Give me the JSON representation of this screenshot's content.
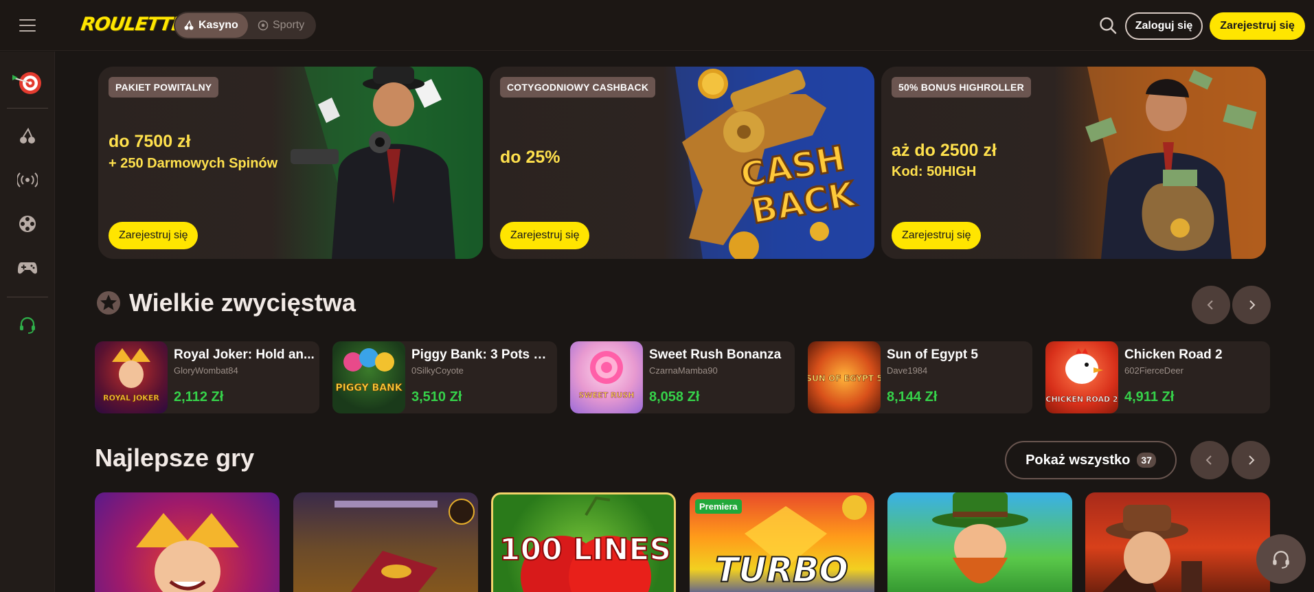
{
  "header": {
    "logo_text": "ROULETTINO",
    "tabs": [
      {
        "label": "Kasyno",
        "active": true
      },
      {
        "label": "Sporty",
        "active": false
      }
    ],
    "login_label": "Zaloguj się",
    "register_label": "Zarejestruj się"
  },
  "sidebar": {
    "items": [
      "dart-target-icon",
      "cherries-icon",
      "live-broadcast-icon",
      "film-reel-icon",
      "gamepad-icon",
      "headset-icon"
    ]
  },
  "banners": [
    {
      "tag": "PAKIET POWITALNY",
      "amount": "do 7500 zł",
      "sub": "+ 250 Darmowych Spinów",
      "cta": "Zarejestruj się"
    },
    {
      "tag": "COTYGODNIOWY CASHBACK",
      "amount": "do 25%",
      "sub": "",
      "cta": "Zarejestruj się",
      "art_text_1": "CASH",
      "art_text_2": "BACK"
    },
    {
      "tag": "50% BONUS HIGHROLLER",
      "amount": "aż do 2500 zł",
      "sub": "Kod: 50HIGH",
      "cta": "Zarejestruj się"
    }
  ],
  "big_wins": {
    "title": "Wielkie zwycięstwa",
    "items": [
      {
        "game": "Royal Joker: Hold an...",
        "user": "GloryWombat84",
        "prize": "2,112 Zł",
        "thumb_text": "ROYAL JOKER"
      },
      {
        "game": "Piggy Bank: 3 Pots B...",
        "user": "0SilkyCoyote",
        "prize": "3,510 Zł",
        "thumb_text": "PIGGY BANK"
      },
      {
        "game": "Sweet Rush Bonanza",
        "user": "CzarnaMamba90",
        "prize": "8,058 Zł",
        "thumb_text": "SWEET RUSH"
      },
      {
        "game": "Sun of Egypt 5",
        "user": "Dave1984",
        "prize": "8,144 Zł",
        "thumb_text": "SUN OF EGYPT 5"
      },
      {
        "game": "Chicken Road 2",
        "user": "602FierceDeer",
        "prize": "4,911 Zł",
        "thumb_text": "CHICKEN ROAD 2"
      }
    ]
  },
  "best_games": {
    "title": "Najlepsze gry",
    "show_all_label": "Pokaż wszystko",
    "show_all_count": "37",
    "tiles": [
      {
        "name": "joker-tile",
        "label": ""
      },
      {
        "name": "egypt-book-tile",
        "label": ""
      },
      {
        "name": "100-lines-tile",
        "label": "100 LINES"
      },
      {
        "name": "turbo-tile",
        "label": "TURBO",
        "badge": "Premiera"
      },
      {
        "name": "leprechaun-tile",
        "label": ""
      },
      {
        "name": "explorer-tile",
        "label": ""
      }
    ]
  },
  "colors": {
    "accent_yellow": "#ffe500",
    "prize_green": "#36d24a",
    "background": "#1a1614",
    "tag_bg": "#6b5550"
  }
}
